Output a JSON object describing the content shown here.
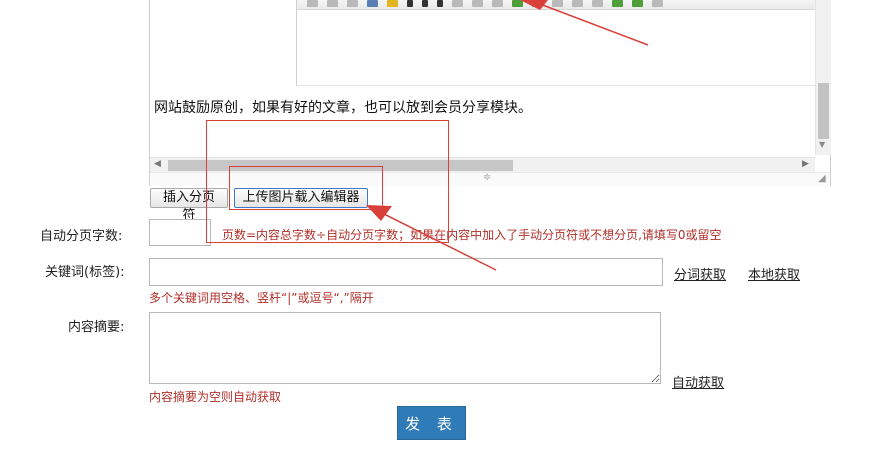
{
  "editor": {
    "content_text": "网站鼓励原创，如果有好的文章，也可以放到会员分享模块。"
  },
  "buttons": {
    "insert_page_break": "插入分页符",
    "upload_image": "上传图片载入编辑器",
    "submit": "发 表"
  },
  "form": {
    "auto_page": {
      "label": "自动分页字数:",
      "value": "",
      "hint": "页数=内容总字数÷自动分页字数；如果在内容中加入了手动分页符或不想分页,请填写0或留空"
    },
    "keywords": {
      "label": "关键词(标签):",
      "value": "",
      "link_split": "分词获取",
      "link_local": "本地获取",
      "hint": "多个关键词用空格、竖杆“|”或逗号“,”隔开"
    },
    "summary": {
      "label": "内容摘要:",
      "value": "",
      "link_auto": "自动获取",
      "hint": "内容摘要为空则自动获取"
    }
  },
  "colors": {
    "hint_text": "#b0302a",
    "annotation_red": "#d9403a",
    "submit_bg": "#2f7bb8"
  }
}
